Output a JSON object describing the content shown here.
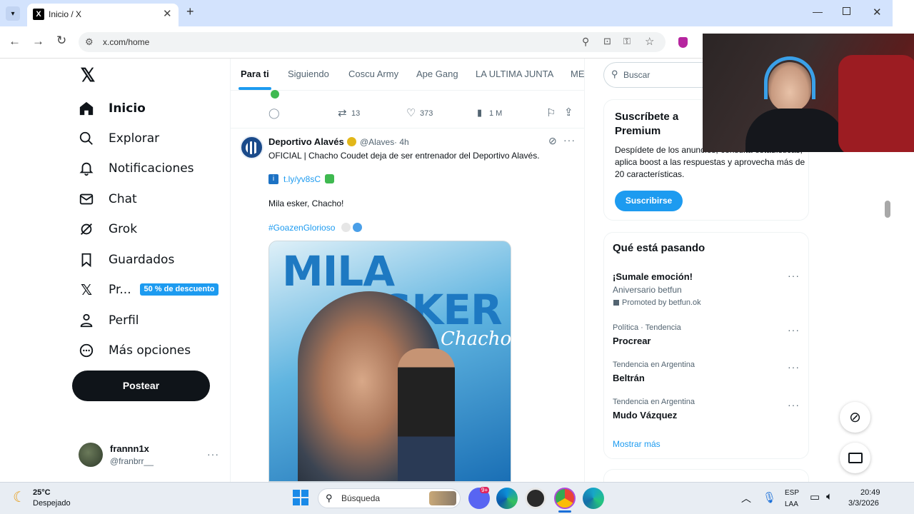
{
  "browser": {
    "tab_title": "Inicio / X",
    "url": "x.com/home"
  },
  "sidebar": {
    "items": [
      {
        "label": "Inicio"
      },
      {
        "label": "Explorar"
      },
      {
        "label": "Notificaciones"
      },
      {
        "label": "Chat"
      },
      {
        "label": "Grok"
      },
      {
        "label": "Guardados"
      },
      {
        "label": "Pr..."
      },
      {
        "label": "Perfil"
      },
      {
        "label": "Más opciones"
      }
    ],
    "premium_badge": "50 % de descuento",
    "post_button": "Postear",
    "user": {
      "name": "frannn1x",
      "handle": "@franbrr__"
    }
  },
  "feed": {
    "tabs": [
      "Para ti",
      "Siguiendo",
      "Coscu Army",
      "Ape Gang",
      "LA ULTIMA JUNTA",
      "ME"
    ],
    "prev_actions": {
      "retweets": "13",
      "likes": "373",
      "views": "1 M"
    },
    "tweet": {
      "author": "Deportivo Alavés",
      "handle": "@Alaves",
      "time": "· 4h",
      "text": "OFICIAL | Chacho Coudet deja de ser entrenador del Deportivo Alavés.",
      "link": "t.ly/yv8sC",
      "text2": "Mila esker, Chacho!",
      "hashtag": "#GoazenGlorioso",
      "image_line1": "MILA",
      "image_line2": "ESKER",
      "image_script": "Chacho"
    }
  },
  "right": {
    "search_placeholder": "Buscar",
    "premium": {
      "title": "Suscríbete a Premium",
      "desc": "Despídete de los anuncios, consulta estadísticas, aplica boost a las respuestas y aprovecha más de 20 características.",
      "button": "Suscribirse"
    },
    "trends_title": "Qué está pasando",
    "trends": [
      {
        "meta": "",
        "name": "¡Sumale emoción!",
        "sub": "Aniversario betfun",
        "promo": "Promoted by betfun.ok"
      },
      {
        "meta": "Política · Tendencia",
        "name": "Procrear"
      },
      {
        "meta": "Tendencia en Argentina",
        "name": "Beltrán"
      },
      {
        "meta": "Tendencia en Argentina",
        "name": "Mudo Vázquez"
      }
    ],
    "show_more": "Mostrar más"
  },
  "taskbar": {
    "weather_temp": "25°C",
    "weather_desc": "Despejado",
    "search": "Búsqueda",
    "lang1": "ESP",
    "lang2": "LAA",
    "time": "20:49",
    "date": "3/3/2026",
    "discord_badge": "9+"
  },
  "colors": {
    "accent": "#1d9bf0",
    "premium_badge": "#1d9bf0",
    "tab_bar": "#d3e3fd",
    "post_button": "#0f1419"
  }
}
